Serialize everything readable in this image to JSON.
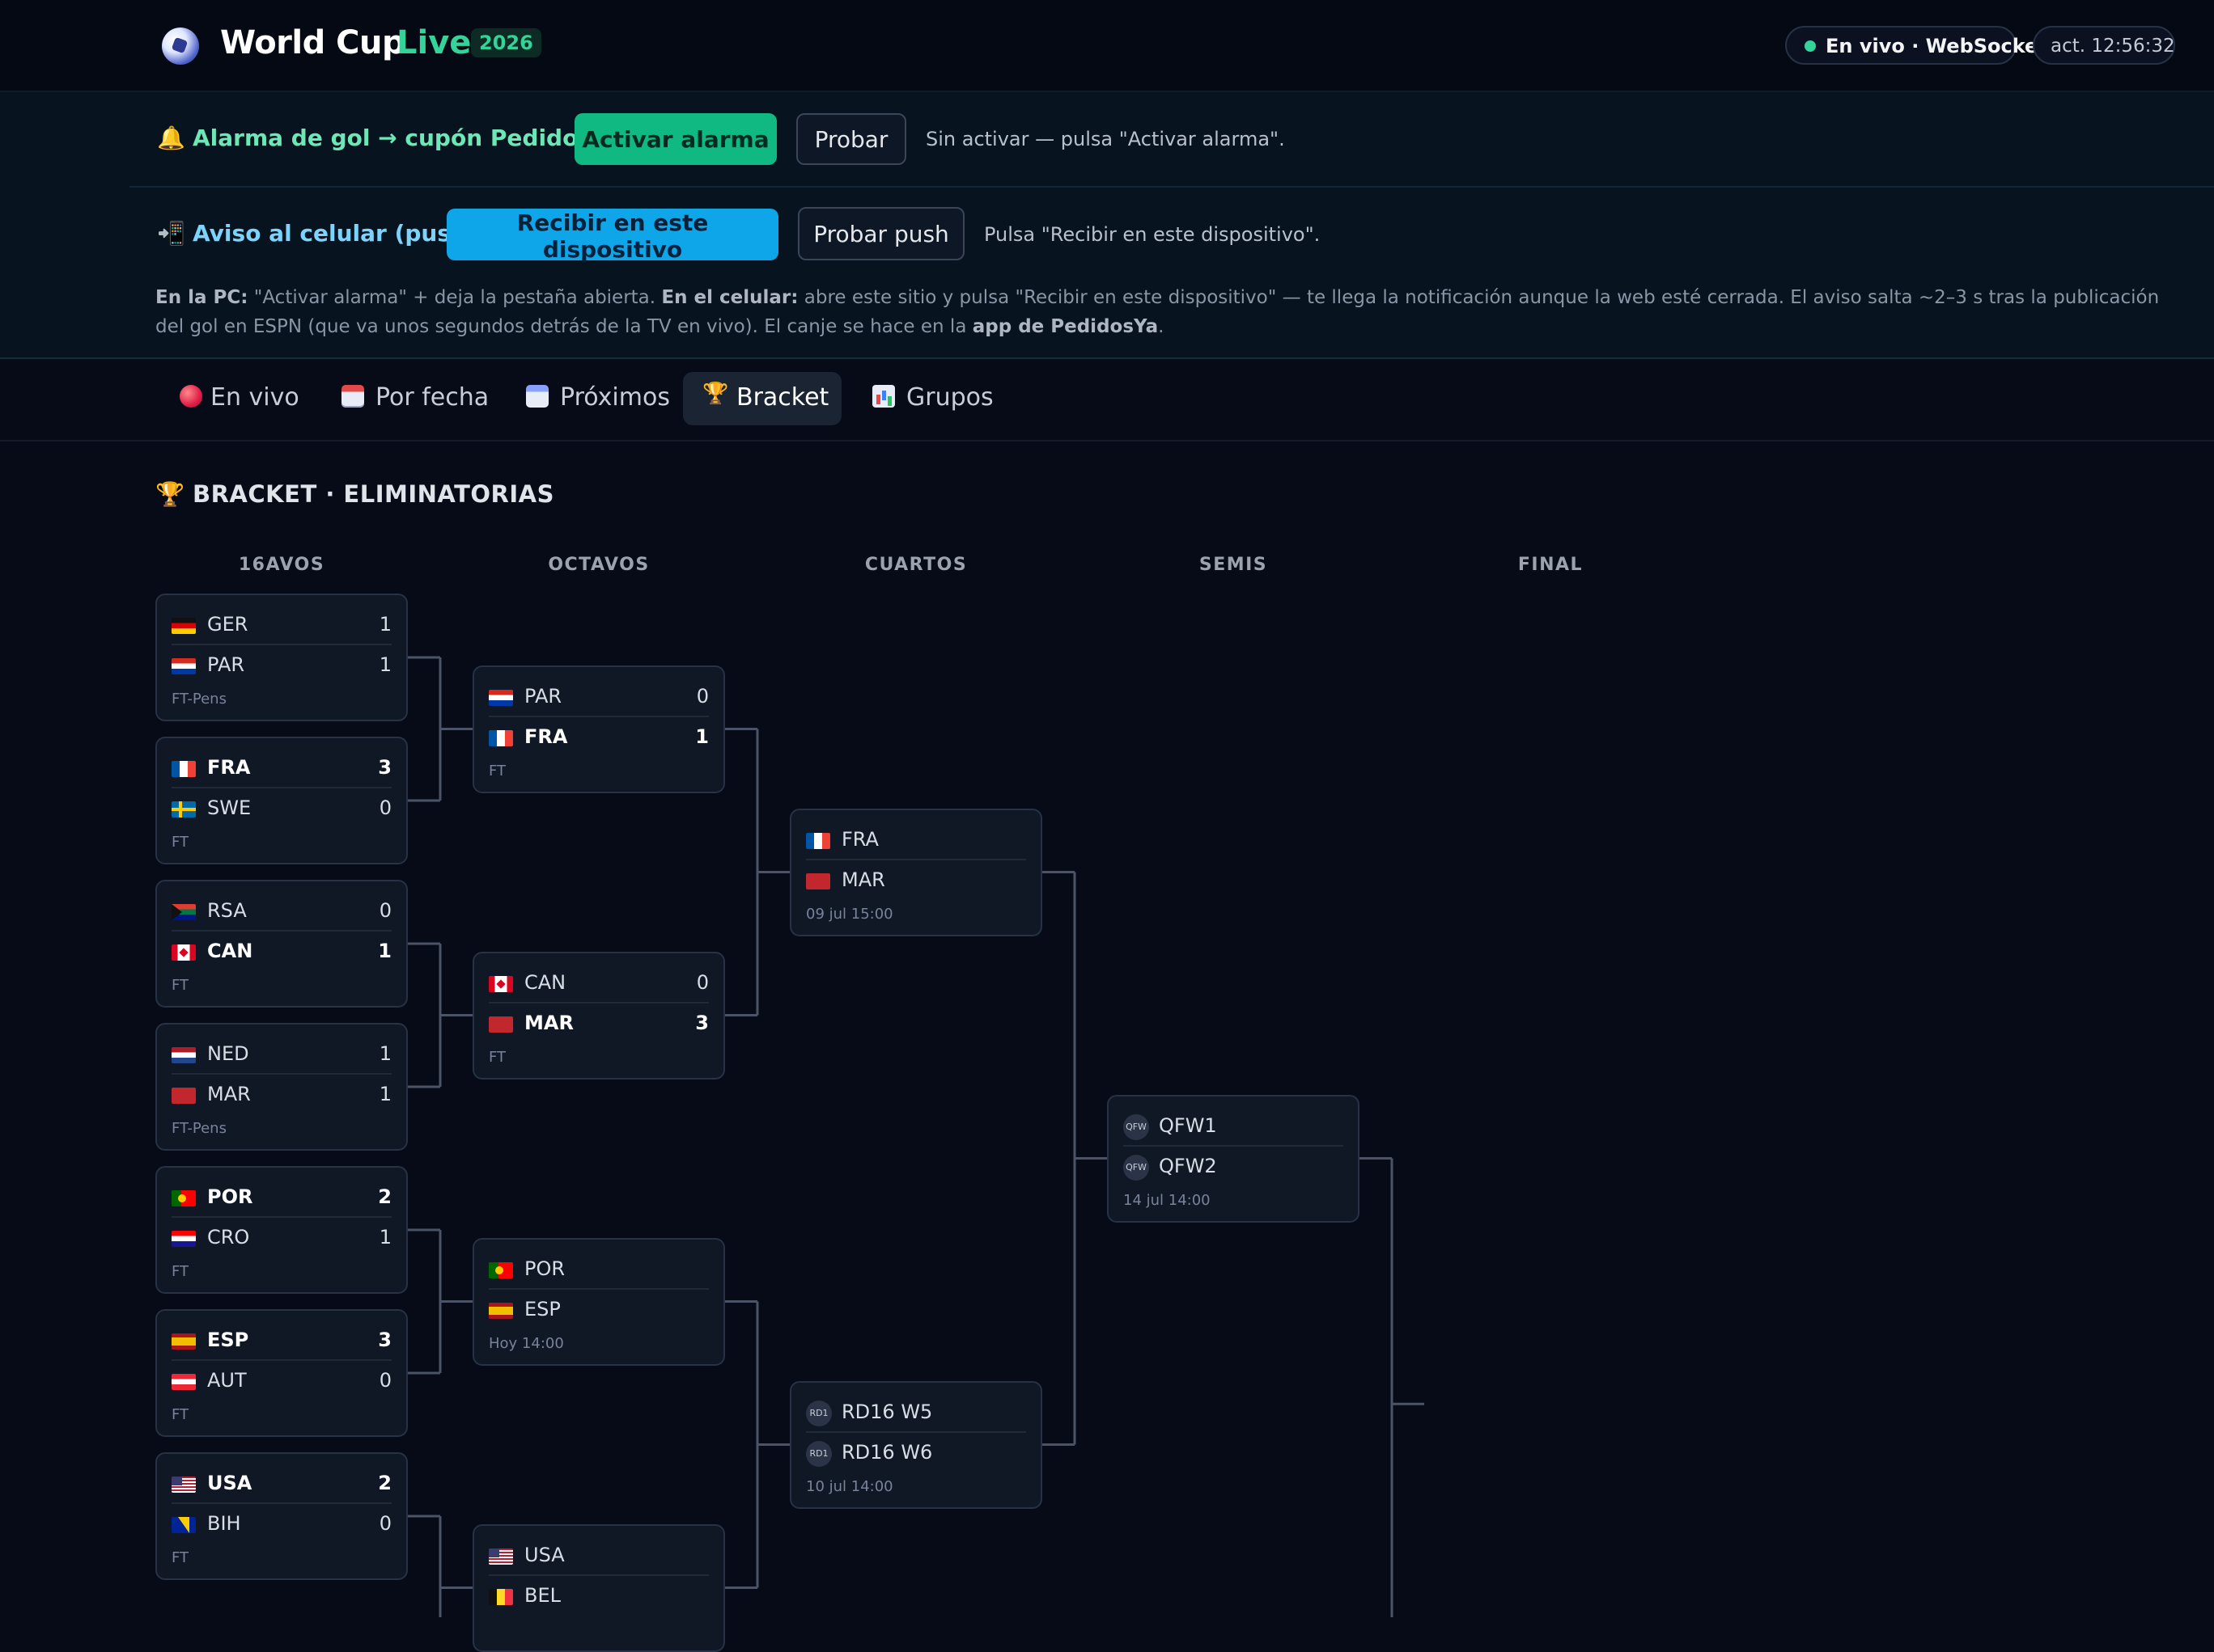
{
  "header": {
    "title": "World Cup",
    "title_accent": "Live",
    "year": "2026",
    "status": "En vivo · WebSocket",
    "updated": "act. 12:56:32"
  },
  "alarm": {
    "label": "Alarma de gol → cupón PedidosYa",
    "activate_label": "Activar alarma",
    "test_label": "Probar",
    "hint": "Sin activar — pulsa \"Activar alarma\"."
  },
  "push": {
    "label": "Aviso al celular (push)",
    "receive_label": "Recibir en este dispositivo",
    "test_label": "Probar push",
    "hint": "Pulsa \"Recibir en este dispositivo\"."
  },
  "info": {
    "pc_label": "En la PC:",
    "pc_text": " \"Activar alarma\" + deja la pestaña abierta. ",
    "phone_label": "En el celular:",
    "phone_text": " abre este sitio y pulsa \"Recibir en este dispositivo\" — te llega la notificación aunque la web esté cerrada. El aviso salta ~2–3 s tras la publicación del gol en ESPN (que va unos segundos detrás de la TV en vivo). El canje se hace en la ",
    "app_label": "app de PedidosYa",
    "end": "."
  },
  "tabs": [
    {
      "label": "En vivo",
      "icon": "red-dot-icon"
    },
    {
      "label": "Por fecha",
      "icon": "calendar-icon"
    },
    {
      "label": "Próximos",
      "icon": "calendar-spiral-icon"
    },
    {
      "label": "Bracket",
      "icon": "trophy-icon",
      "active": true
    },
    {
      "label": "Grupos",
      "icon": "bar-chart-icon"
    }
  ],
  "bracket": {
    "title": "BRACKET · ELIMINATORIAS",
    "rounds": [
      "16AVOS",
      "OCTAVOS",
      "CUARTOS",
      "SEMIS",
      "FINAL"
    ],
    "r32": [
      {
        "t1": {
          "code": "GER",
          "flag": "ger",
          "score": "1"
        },
        "t2": {
          "code": "PAR",
          "flag": "par",
          "score": "1"
        },
        "status": "FT-Pens"
      },
      {
        "t1": {
          "code": "FRA",
          "flag": "fra",
          "score": "3",
          "win": true
        },
        "t2": {
          "code": "SWE",
          "flag": "swe",
          "score": "0"
        },
        "status": "FT"
      },
      {
        "t1": {
          "code": "RSA",
          "flag": "rsa",
          "score": "0"
        },
        "t2": {
          "code": "CAN",
          "flag": "can",
          "score": "1",
          "win": true
        },
        "status": "FT"
      },
      {
        "t1": {
          "code": "NED",
          "flag": "ned",
          "score": "1"
        },
        "t2": {
          "code": "MAR",
          "flag": "mar",
          "score": "1"
        },
        "status": "FT-Pens"
      },
      {
        "t1": {
          "code": "POR",
          "flag": "por",
          "score": "2",
          "win": true
        },
        "t2": {
          "code": "CRO",
          "flag": "cro",
          "score": "1"
        },
        "status": "FT"
      },
      {
        "t1": {
          "code": "ESP",
          "flag": "esp",
          "score": "3",
          "win": true
        },
        "t2": {
          "code": "AUT",
          "flag": "aut",
          "score": "0"
        },
        "status": "FT"
      },
      {
        "t1": {
          "code": "USA",
          "flag": "usa",
          "score": "2",
          "win": true
        },
        "t2": {
          "code": "BIH",
          "flag": "bih",
          "score": "0"
        },
        "status": "FT"
      }
    ],
    "r16": [
      {
        "t1": {
          "code": "PAR",
          "flag": "par",
          "score": "0"
        },
        "t2": {
          "code": "FRA",
          "flag": "fra",
          "score": "1",
          "win": true
        },
        "status": "FT"
      },
      {
        "t1": {
          "code": "CAN",
          "flag": "can",
          "score": "0"
        },
        "t2": {
          "code": "MAR",
          "flag": "mar",
          "score": "3",
          "win": true
        },
        "status": "FT"
      },
      {
        "t1": {
          "code": "POR",
          "flag": "por",
          "score": ""
        },
        "t2": {
          "code": "ESP",
          "flag": "esp",
          "score": ""
        },
        "status": "Hoy 14:00"
      },
      {
        "t1": {
          "code": "USA",
          "flag": "usa",
          "score": ""
        },
        "t2": {
          "code": "BEL",
          "flag": "bel",
          "score": ""
        },
        "status": ""
      }
    ],
    "qf": [
      {
        "t1": {
          "code": "FRA",
          "flag": "fra",
          "score": ""
        },
        "t2": {
          "code": "MAR",
          "flag": "mar",
          "score": ""
        },
        "status": "09 jul 15:00"
      },
      {
        "t1": {
          "code": "RD16 W5",
          "ph": "RD1",
          "score": ""
        },
        "t2": {
          "code": "RD16 W6",
          "ph": "RD1",
          "score": ""
        },
        "status": "10 jul 14:00"
      }
    ],
    "sf": [
      {
        "t1": {
          "code": "QFW1",
          "ph": "QFW",
          "score": ""
        },
        "t2": {
          "code": "QFW2",
          "ph": "QFW",
          "score": ""
        },
        "status": "14 jul 14:00"
      }
    ]
  }
}
